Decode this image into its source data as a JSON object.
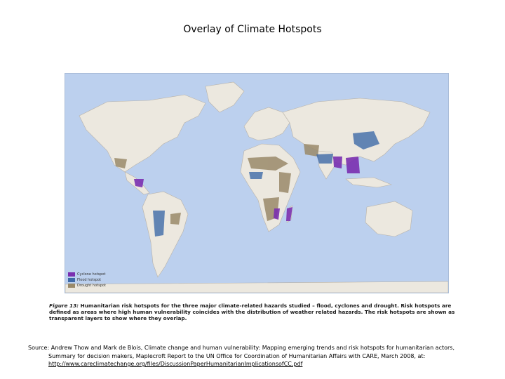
{
  "title": "Overlay of Climate Hotspots",
  "legend": [
    {
      "label": "Cyclone hotspot",
      "color": "#7a2fb0"
    },
    {
      "label": "Flood hotspot",
      "color": "#3f6aa8"
    },
    {
      "label": "Drought hotspot",
      "color": "#9a8a6a"
    }
  ],
  "colors": {
    "ocean": "#bcd0ee",
    "land": "#ece8df",
    "border": "#b8b2a8"
  },
  "caption": {
    "figure": "Figure 13:",
    "text": "Humanitarian risk hotspots for the three major climate-related hazards studied – flood, cyclones and drought. Risk hotspots are defined as areas where high human vulnerability coincides with the distribution of weather related hazards. The risk hotspots are shown as transparent layers to show where they overlap."
  },
  "source": {
    "line1": "Source: Andrew Thow and Mark de Blois, Climate change and human vulnerability: Mapping emerging trends and risk hotspots for humanitarian actors,",
    "line2": "Summary for decision makers,  Maplecroft Report to the UN Office for Coordination of Humanitarian Affairs with CARE, March 2008, at:",
    "link": "http://www.careclimatechange.org/files/DiscussionPaperHumanitarianImplicationsofCC.pdf"
  }
}
